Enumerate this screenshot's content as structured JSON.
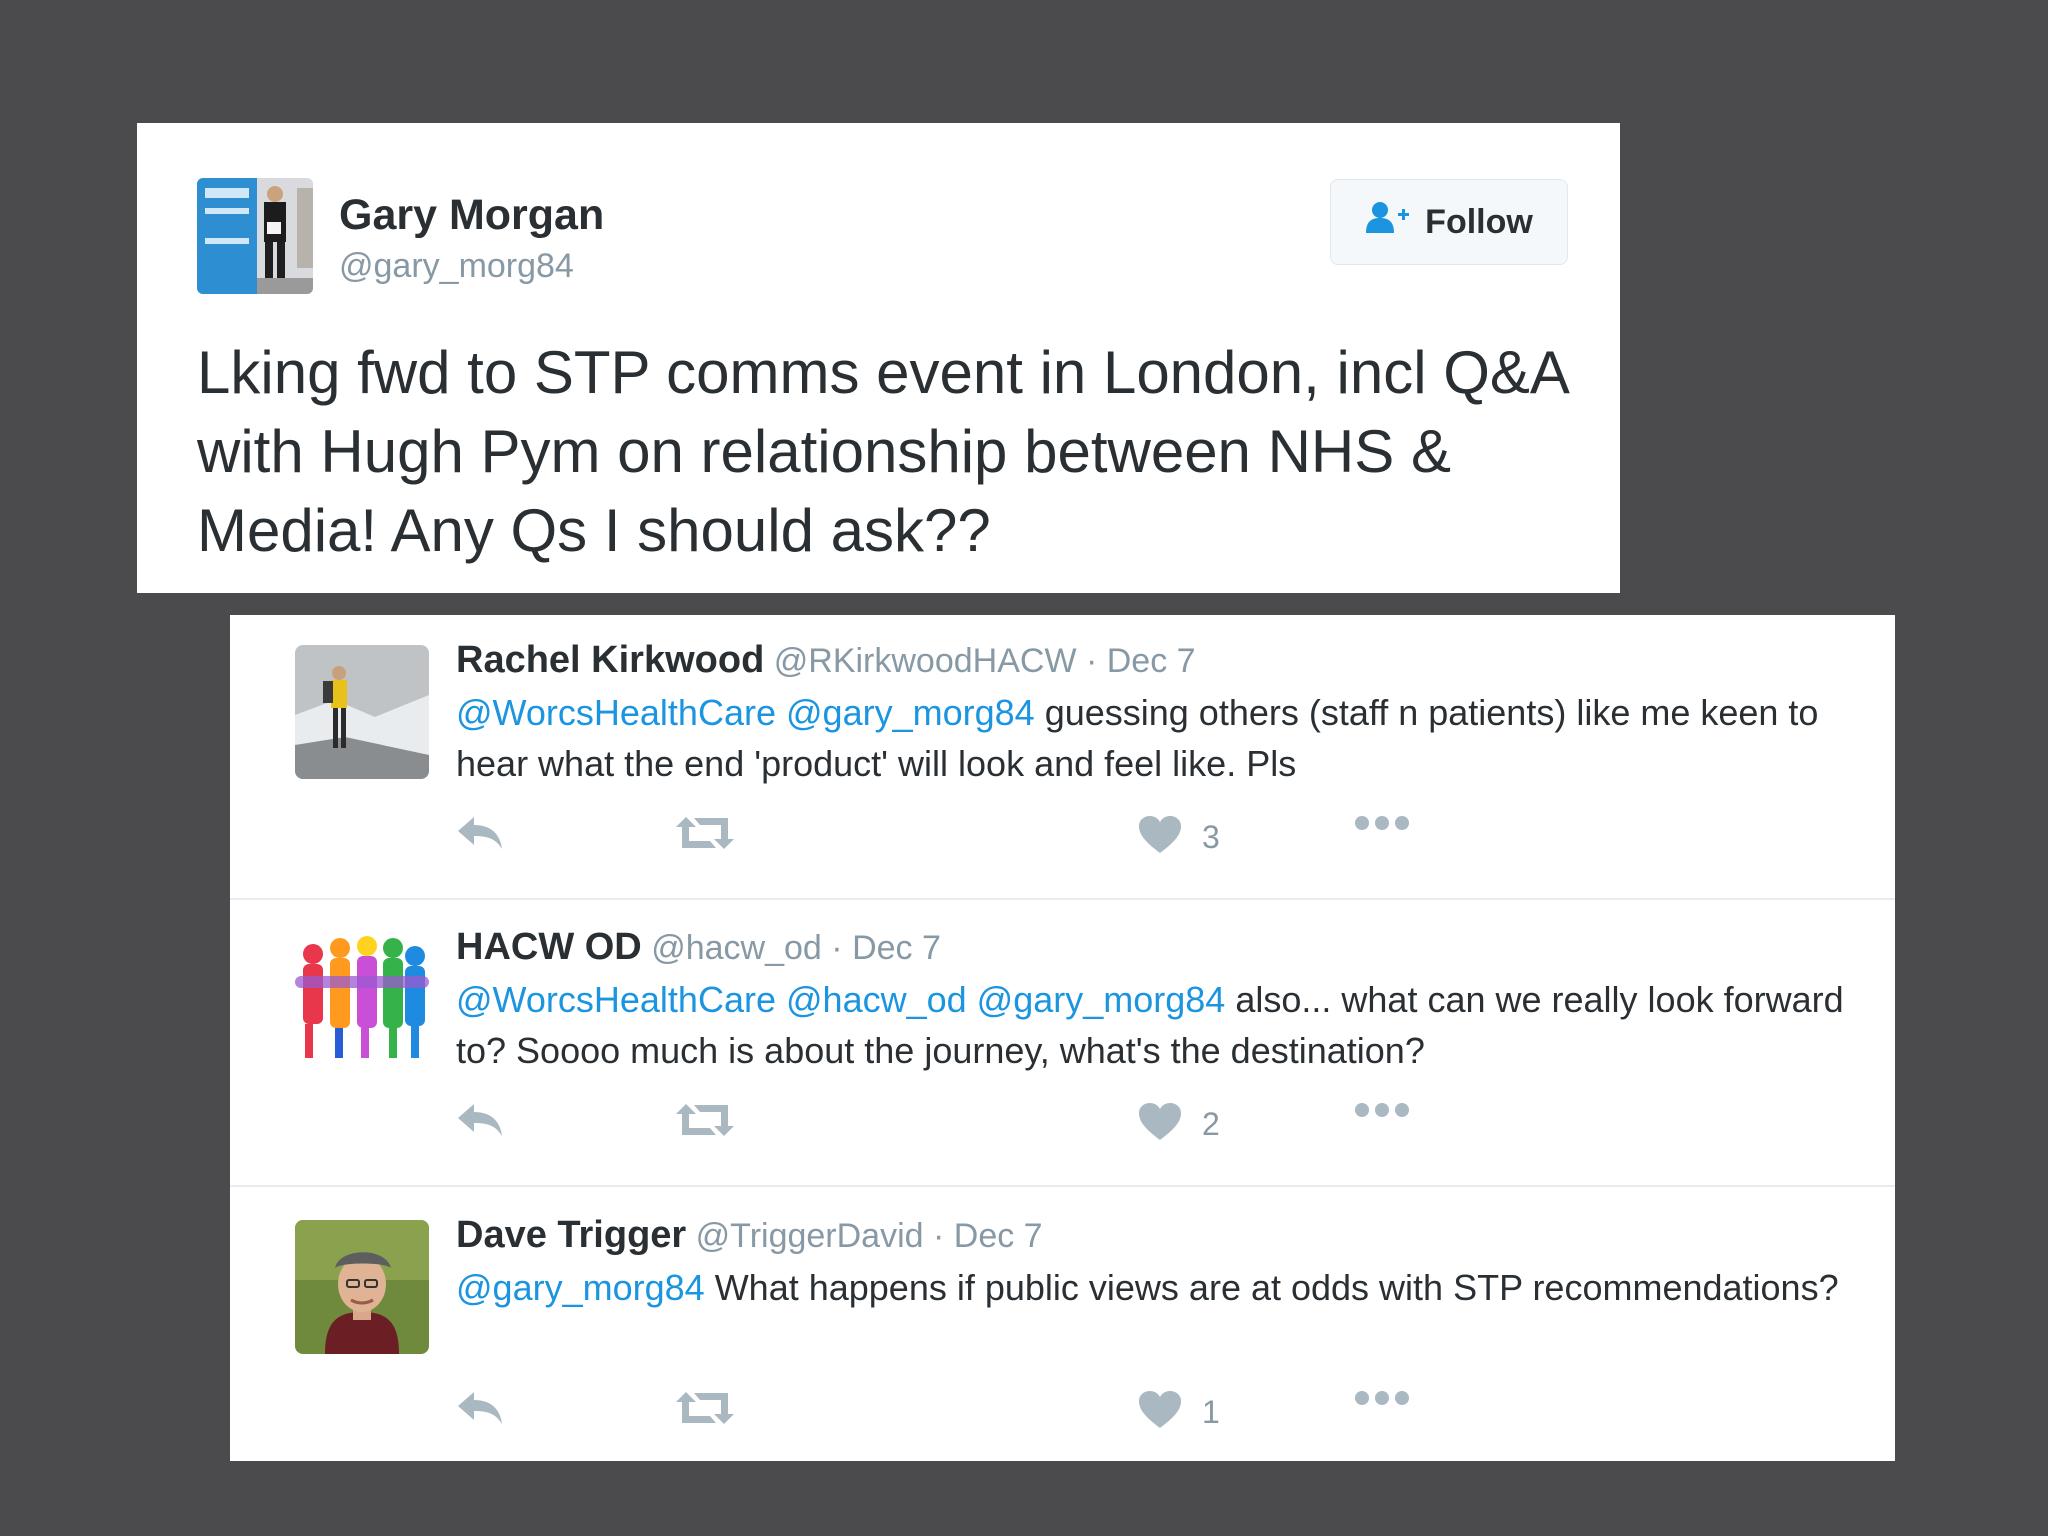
{
  "main_tweet": {
    "name": "Gary Morgan",
    "handle": "@gary_morg84",
    "follow_label": "Follow",
    "text": "Lking fwd to STP comms event in London, incl Q&A with Hugh Pym on relationship between NHS & Media! Any Qs I should ask??"
  },
  "replies": [
    {
      "name": "Rachel Kirkwood",
      "handle": "@RKirkwoodHACW",
      "date": "· Dec 7",
      "mentions": [
        "@WorcsHealthCare",
        "@gary_morg84"
      ],
      "text": "guessing others (staff n patients) like me keen to hear what the end 'product' will look and feel like. Pls",
      "likes": "3"
    },
    {
      "name": "HACW OD",
      "handle": "@hacw_od",
      "date": "· Dec 7",
      "mentions": [
        "@WorcsHealthCare",
        "@hacw_od",
        "@gary_morg84"
      ],
      "text": "also... what can we really look forward to? Soooo much is about the journey, what's the destination?",
      "likes": "2"
    },
    {
      "name": "Dave Trigger",
      "handle": "@TriggerDavid",
      "date": "· Dec 7",
      "mentions": [
        "@gary_morg84"
      ],
      "text": "What happens if public views are at odds with STP recommendations?",
      "likes": "1"
    }
  ],
  "colors": {
    "background": "#4b4b4d",
    "link": "#1b95e0",
    "text": "#292f33",
    "muted": "#8899a6",
    "follow_icon": "#1b95e0"
  },
  "icons": [
    "follow-user-icon",
    "reply-icon",
    "retweet-icon",
    "heart-icon",
    "more-icon"
  ]
}
